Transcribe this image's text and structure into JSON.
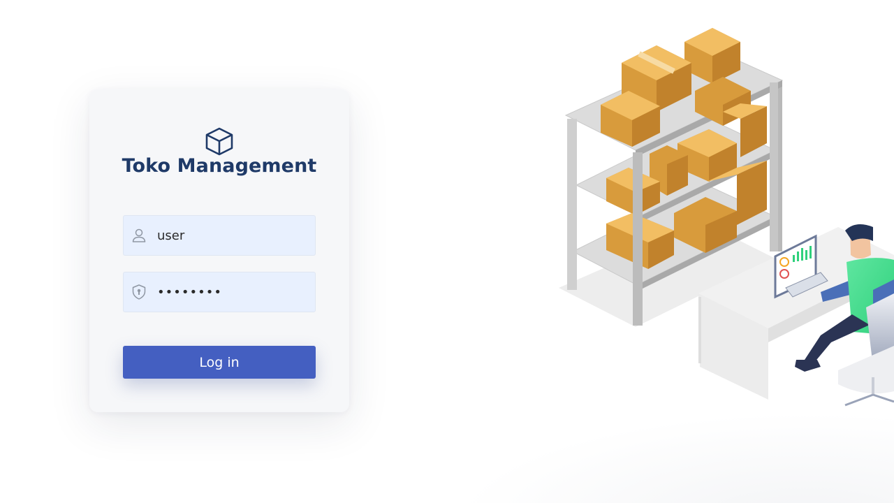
{
  "app": {
    "title": "Toko Management"
  },
  "login": {
    "username": {
      "value": "user",
      "icon": "user-icon"
    },
    "password": {
      "value": "password",
      "icon": "shield-lock-icon"
    },
    "submit_label": "Log in"
  },
  "colors": {
    "accent": "#445fc1",
    "title": "#1f3a68",
    "field_bg": "#e8f0fe",
    "card_bg": "#f6f7f9"
  },
  "illustration": {
    "subject": "warehouse-worker-illustration"
  }
}
